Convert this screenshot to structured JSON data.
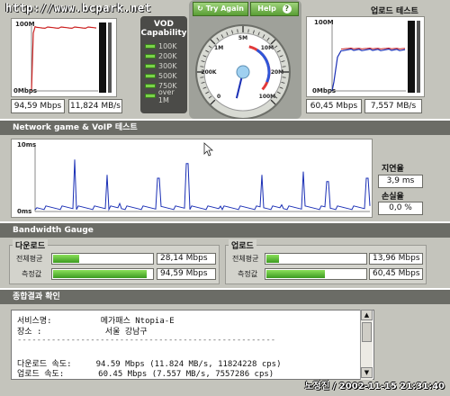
{
  "watermark": "http://www.bcpark.net",
  "buttons": {
    "try_again": "Try Again",
    "help": "Help",
    "help_icon": "?"
  },
  "download": {
    "y_top": "100M",
    "y_bottom": "0Mbps",
    "mbps": "94,59 Mbps",
    "mbs": "11,824 MB/s",
    "level": 0.95
  },
  "upload": {
    "title": "업로드 테스트",
    "y_top": "100M",
    "y_bottom": "0Mbps",
    "mbps": "60,45 Mbps",
    "mbs": "7,557 MB/s",
    "level": 0.6
  },
  "vod": {
    "title_line1": "VOD",
    "title_line2": "Capability",
    "items": [
      "100K",
      "200K",
      "300K",
      "500K",
      "750K",
      "over 1M"
    ]
  },
  "gauge": {
    "labels": [
      "0",
      "200K",
      "1M",
      "5M",
      "10M",
      "20M",
      "100M"
    ],
    "download_value_mbps": 94.59,
    "upload_value_mbps": 60.45,
    "colors": {
      "download": "#e23a3a",
      "upload": "#2f55d8"
    }
  },
  "network": {
    "title": "Network game & VoIP 테스트",
    "y_top": "10ms",
    "y_bottom": "0ms",
    "latency_label": "지연율",
    "latency_value": "3,9 ms",
    "loss_label": "손실율",
    "loss_value": "0,0 %"
  },
  "bandwidth": {
    "title": "Bandwidth Gauge",
    "download": {
      "label": "다운로드",
      "avg_label": "전체평균",
      "avg_value": "28,14 Mbps",
      "avg_level": 0.28,
      "measured_label": "측정값",
      "measured_value": "94,59 Mbps",
      "measured_level": 0.95
    },
    "upload": {
      "label": "업로드",
      "avg_label": "전체평균",
      "avg_value": "13,96 Mbps",
      "avg_level": 0.14,
      "measured_label": "측정값",
      "measured_value": "60,45 Mbps",
      "measured_level": 0.6
    }
  },
  "result": {
    "title": "종합결과 확인",
    "lines": [
      "서비스명:          메가패스 Ntopia-E",
      "장소 :             서울 강남구",
      "-----------------------------------------------------",
      "",
      "다운로드 속도:     94.59 Mbps (11.824 MB/s, 11824228 cps)",
      "업로드 속도:       60.45 Mbps (7.557 MB/s, 7557286 cps)"
    ]
  },
  "stamp": "노정진 / 2002-11-15 21:31:40",
  "colors": {
    "frame": "#c4c4bc",
    "bar": "#6b6c66",
    "accent_green": "#5a9e35",
    "trace_red": "#cc2222",
    "trace_blue": "#1a2fb5"
  }
}
